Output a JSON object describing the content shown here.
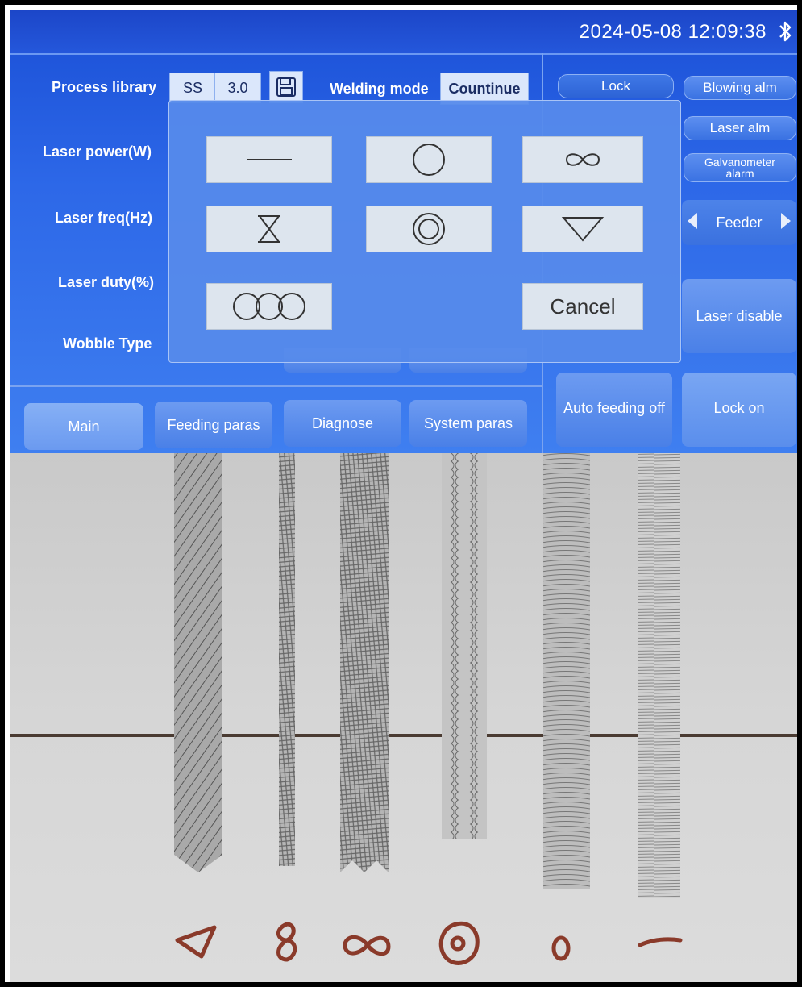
{
  "status": {
    "datetime": "2024-05-08 12:09:38",
    "bluetooth_icon": "bluetooth-icon"
  },
  "params": {
    "process_library_label": "Process library",
    "material": "SS",
    "thickness": "3.0",
    "save_icon": "save-icon",
    "welding_mode_label": "Welding mode",
    "welding_mode_value": "Countinue",
    "laser_power_label": "Laser power(W)",
    "laser_freq_label": "Laser freq(Hz)",
    "laser_duty_label": "Laser duty(%)",
    "wobble_type_label": "Wobble Type"
  },
  "alarms": {
    "lock": "Lock",
    "blowing_alm": "Blowing alm",
    "laser_alm": "Laser alm",
    "galvanometer_alarm": "Galvanometer alarm"
  },
  "feeder": {
    "label": "Feeder"
  },
  "controls": {
    "laser_disable": "Laser disable",
    "auto_feeding_off": "Auto feeding off",
    "lock_on": "Lock on"
  },
  "tabs": [
    {
      "label": "Main"
    },
    {
      "label": "Feeding paras"
    },
    {
      "label": "Diagnose"
    },
    {
      "label": "System paras"
    }
  ],
  "wobble_popup": {
    "options": [
      "line-icon",
      "circle-icon",
      "infinity-icon",
      "hourglass-icon",
      "double-circle-icon",
      "triangle-icon",
      "triple-circle-icon"
    ],
    "cancel": "Cancel"
  },
  "colors": {
    "screen_blue": "#2d68e8",
    "button_blue": "#4a80e7",
    "popup_button": "#dde5ee",
    "marker_red": "#8a3a2a"
  }
}
